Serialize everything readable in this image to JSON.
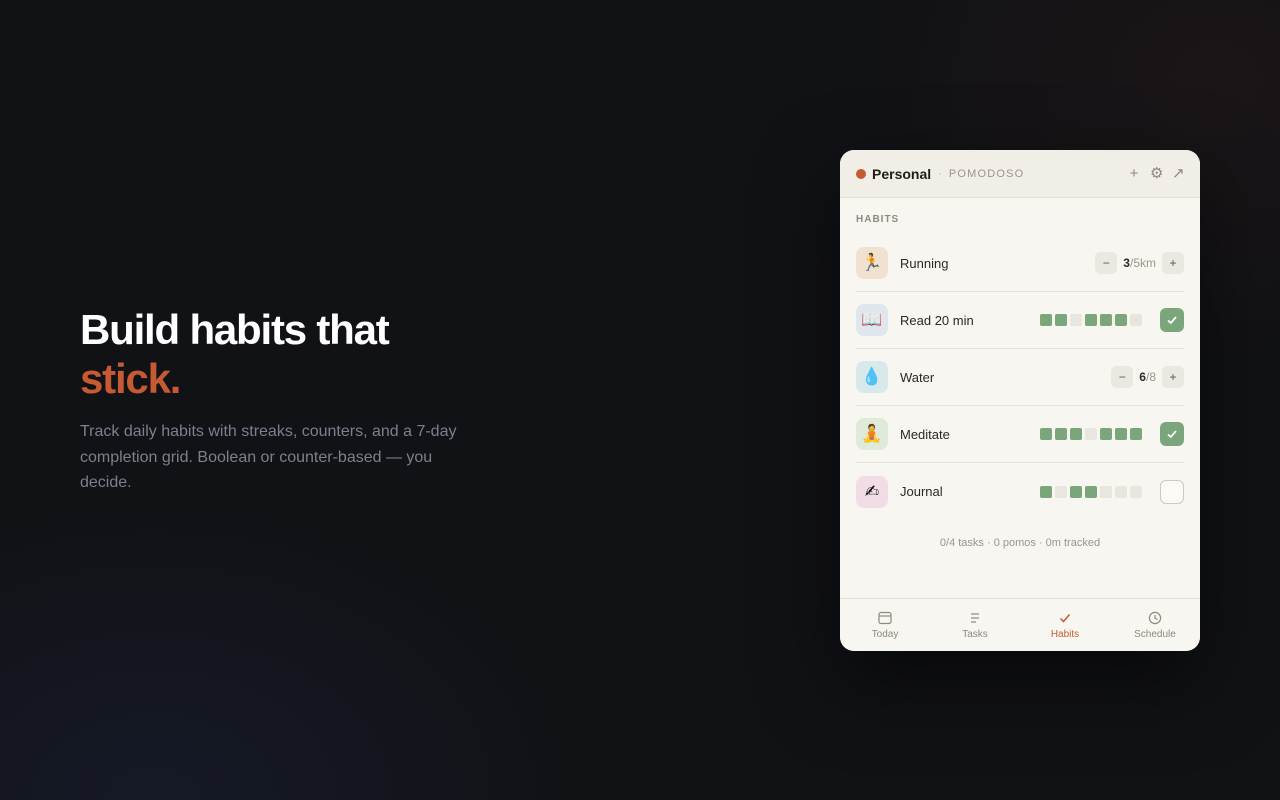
{
  "hero": {
    "title_line1": "Build habits that",
    "title_line2": "stick.",
    "subtitle": "Track daily habits with streaks, counters, and a 7-day completion grid. Boolean or counter-based — you decide."
  },
  "widget": {
    "workspace": "Personal",
    "separator": "·",
    "brand": "POMODOSO",
    "actions": {
      "add": "+",
      "settings": "⚙",
      "expand": "↗"
    },
    "section_label": "HABITS",
    "habits": [
      {
        "name": "Running",
        "icon": "🏃",
        "icon_bg": "#f1e2cf",
        "type": "counter",
        "current": "3",
        "target": "/5km"
      },
      {
        "name": "Read 20 min",
        "icon": "📖",
        "icon_bg": "#dfe6ee",
        "type": "boolean",
        "grid": [
          1,
          1,
          0,
          1,
          1,
          1,
          0
        ],
        "checked": true
      },
      {
        "name": "Water",
        "icon": "💧",
        "icon_bg": "#d7e9ea",
        "type": "counter",
        "current": "6",
        "target": "/8"
      },
      {
        "name": "Meditate",
        "icon": "🧘",
        "icon_bg": "#dfeadb",
        "type": "boolean",
        "grid": [
          1,
          1,
          1,
          0,
          1,
          1,
          1
        ],
        "checked": true
      },
      {
        "name": "Journal",
        "icon": "✍",
        "icon_bg": "#f1dde6",
        "type": "boolean",
        "grid": [
          1,
          0,
          1,
          1,
          0,
          0,
          0
        ],
        "checked": false
      }
    ],
    "stats": "0/4 tasks · 0 pomos · 0m tracked",
    "tabs": [
      {
        "label": "Today",
        "icon": "calendar-icon",
        "active": false
      },
      {
        "label": "Tasks",
        "icon": "list-icon",
        "active": false
      },
      {
        "label": "Habits",
        "icon": "check-icon",
        "active": true
      },
      {
        "label": "Schedule",
        "icon": "clock-icon",
        "active": false
      }
    ],
    "colors": {
      "accent": "#c65a33",
      "done": "#7ba57b"
    }
  }
}
